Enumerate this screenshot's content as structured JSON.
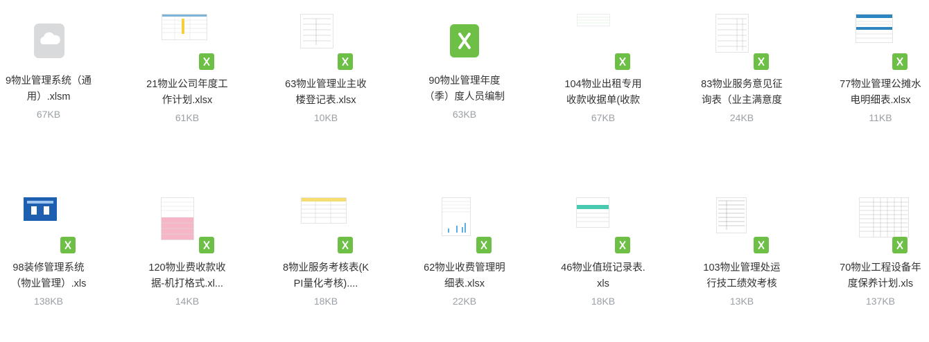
{
  "files": [
    {
      "name": "9物业管理系统（通\n用）.xlsm",
      "size": "67KB",
      "icon": "cloud-file-icon"
    },
    {
      "name": "21物业公司年度工\n作计划.xlsx",
      "size": "61KB",
      "icon": "excel-thumbnail"
    },
    {
      "name": "63物业管理业主收\n楼登记表.xlsx",
      "size": "10KB",
      "icon": "excel-thumbnail"
    },
    {
      "name": "90物业管理年度\n（季）度人员编制",
      "size": "63KB",
      "icon": "excel-icon"
    },
    {
      "name": "104物业出租专用\n收款收据单(收款",
      "size": "67KB",
      "icon": "excel-thumbnail"
    },
    {
      "name": "83物业服务意见征\n询表（业主满意度",
      "size": "24KB",
      "icon": "excel-thumbnail"
    },
    {
      "name": "77物业管理公摊水\n电明细表.xlsx",
      "size": "11KB",
      "icon": "excel-thumbnail"
    },
    {
      "name": "98装修管理系统\n（物业管理）.xls",
      "size": "138KB",
      "icon": "excel-thumbnail"
    },
    {
      "name": "120物业费收款收\n据-机打格式.xl...",
      "size": "14KB",
      "icon": "excel-thumbnail"
    },
    {
      "name": "8物业服务考核表(K\nPI量化考核)....",
      "size": "18KB",
      "icon": "excel-thumbnail"
    },
    {
      "name": "62物业收费管理明\n细表.xlsx",
      "size": "22KB",
      "icon": "excel-thumbnail"
    },
    {
      "name": "46物业值班记录表.\nxls",
      "size": "18KB",
      "icon": "excel-thumbnail"
    },
    {
      "name": "103物业管理处运\n行技工绩效考核",
      "size": "13KB",
      "icon": "excel-thumbnail"
    },
    {
      "name": "70物业工程设备年\n度保养计划.xls",
      "size": "137KB",
      "icon": "excel-thumbnail"
    }
  ],
  "colors": {
    "excel_green": "#6dbf45",
    "text": "#333333",
    "size_text": "#9aa0a6"
  }
}
